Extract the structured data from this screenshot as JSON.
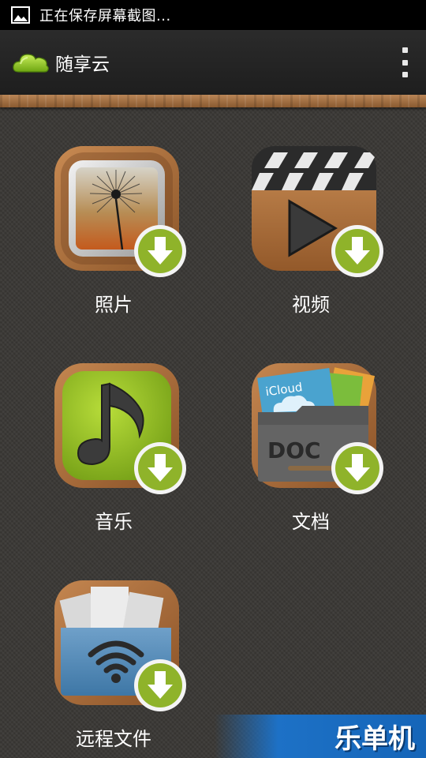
{
  "status_bar": {
    "text": "正在保存屏幕截图..."
  },
  "action_bar": {
    "title": "随享云",
    "menu_icon": "overflow-menu-icon"
  },
  "tiles": [
    {
      "label": "照片",
      "icon": "photo-icon"
    },
    {
      "label": "视频",
      "icon": "video-icon"
    },
    {
      "label": "音乐",
      "icon": "music-icon"
    },
    {
      "label": "文档",
      "icon": "document-icon"
    },
    {
      "label": "远程文件",
      "icon": "remote-files-icon"
    }
  ],
  "document_icon_text": {
    "cloud": "iCloud",
    "doc": "DOC"
  },
  "watermark": {
    "text": "乐单机"
  },
  "colors": {
    "badge": "#8fb32a",
    "wood": "#a0683a",
    "accent_blue": "#1d71c6"
  }
}
